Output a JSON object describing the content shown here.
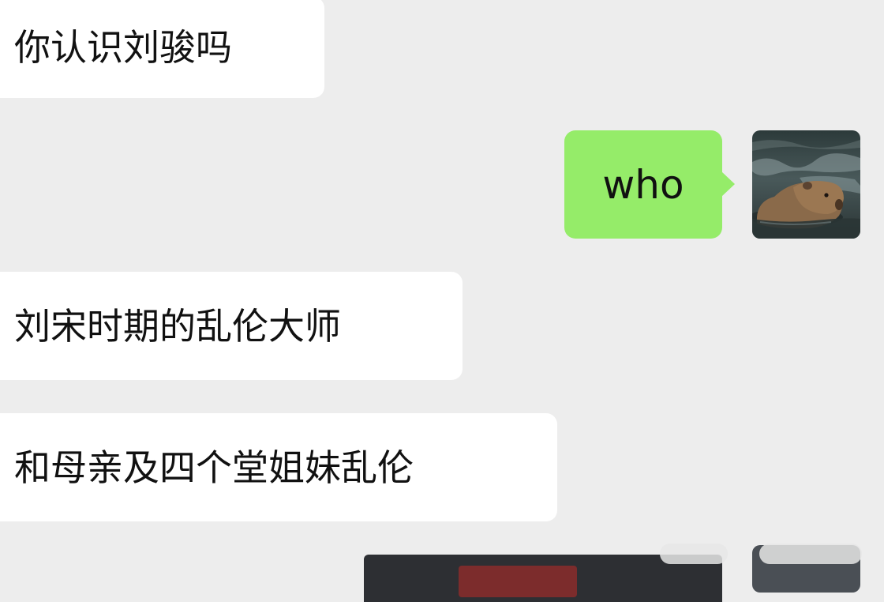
{
  "chat": {
    "messages": [
      {
        "side": "received",
        "text": "你认识刘骏吗"
      },
      {
        "side": "sent",
        "text": "who"
      },
      {
        "side": "received",
        "text": "刘宋时期的乱伦大师"
      },
      {
        "side": "received",
        "text": "和母亲及四个堂姐妹乱伦"
      }
    ]
  },
  "avatar": {
    "icon": "capybara-avatar-icon"
  },
  "colors": {
    "background": "#ededed",
    "received_bubble": "#ffffff",
    "sent_bubble": "#95ec69",
    "text": "#111111"
  }
}
